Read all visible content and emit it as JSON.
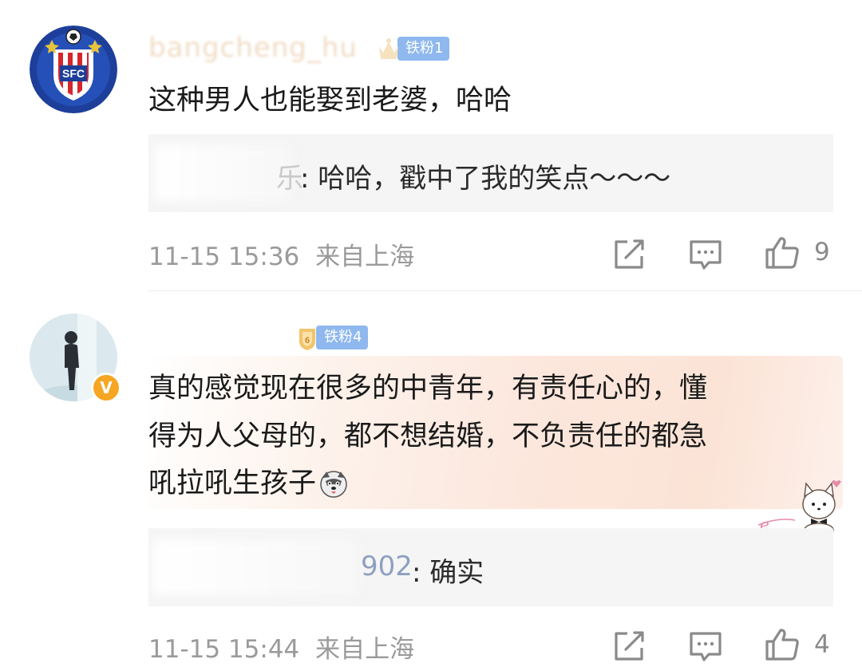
{
  "comments": [
    {
      "username": "bangcheng_hu",
      "badge": "铁粉1",
      "text": "这种男人也能娶到老婆，哈哈",
      "reply": {
        "name": "乐",
        "text": ": 哈哈，戳中了我的笑点～～～"
      },
      "time": "11-15 15:36",
      "location": "来自上海",
      "likes": "9"
    },
    {
      "username": "",
      "badge": "铁粉4",
      "text_lines": [
        "真的感觉现在很多的中青年，有责任心的，懂",
        "得为人父母的，都不想结婚，不负责任的都急",
        "吼拉吼生孩子"
      ],
      "reply": {
        "name": "902",
        "text": ": 确实"
      },
      "time": "11-15 15:44",
      "location": "来自上海",
      "likes": "4"
    }
  ],
  "icons": {
    "share": "share-icon",
    "comment": "comment-icon",
    "like": "thumbs-up-icon",
    "verified": "verified-icon"
  },
  "colors": {
    "badge": "#8fb8ee",
    "meta": "#9a9a9a",
    "reply_name": "#5b7bb3",
    "verified": "#f5a623"
  }
}
